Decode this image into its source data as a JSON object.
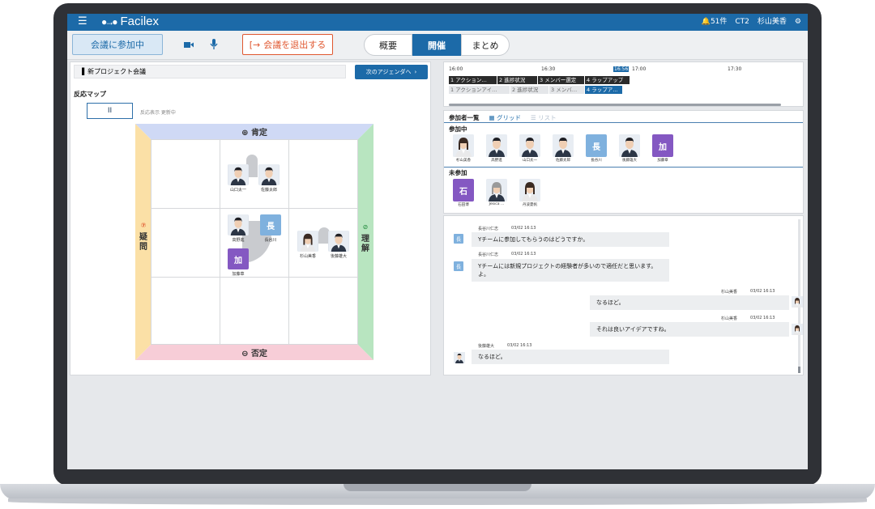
{
  "app": {
    "logo": "Facilex",
    "notifications": "51件",
    "room": "CT2",
    "user": "杉山美香"
  },
  "toolbar": {
    "join_label": "会議に参加中",
    "leave_label": "会議を退出する",
    "tabs": [
      "概要",
      "開催",
      "まとめ"
    ],
    "active_tab": "開催"
  },
  "agenda": {
    "meeting_title": "新プロジェクト会議",
    "next_label": "次のアジェンダへ"
  },
  "reaction_map": {
    "title": "反応マップ",
    "pause_label": "II",
    "status": "反応表示 更新中",
    "top": "肯定",
    "top_sym": "⊕",
    "bottom": "否定",
    "bottom_sym": "⊖",
    "left_sym": "?",
    "left": "疑問",
    "right_sym": "⊘",
    "right": "理解",
    "names": {
      "yamaguchi": "山口太一",
      "sato": "佐藤太郎",
      "takano": "高野進",
      "hasegawa": "長谷川",
      "sugiyama": "杉山美香",
      "goto": "後藤雄大",
      "kato": "加藤章"
    },
    "tile_chars": {
      "hasegawa": "長",
      "kato": "加"
    }
  },
  "timeline": {
    "times": [
      "16:00",
      "16:30",
      "16:56",
      "17:00",
      "17:30"
    ],
    "now": "16:56",
    "actual_row": [
      "1 アクション…",
      "2 進捗状況",
      "3 メンバー選定",
      "4 ラップアップ"
    ],
    "planned_row": [
      "1 アクションアイ…",
      "2 進捗状況",
      "3 メンバ…",
      "4 ラップア…"
    ]
  },
  "participants": {
    "title": "参加者一覧",
    "grid_label": "グリッド",
    "list_label": "リスト",
    "joined_label": "参加中",
    "absent_label": "未参加",
    "joined": [
      {
        "name": "杉山美香",
        "type": "face-f"
      },
      {
        "name": "高野進",
        "type": "face-m"
      },
      {
        "name": "山口太一",
        "type": "face-m"
      },
      {
        "name": "佐藤太郎",
        "type": "face-m"
      },
      {
        "name": "長谷川",
        "type": "tile-b",
        "char": "長"
      },
      {
        "name": "後藤雄大",
        "type": "face-m"
      },
      {
        "name": "加藤章",
        "type": "tile-p",
        "char": "加"
      }
    ],
    "absent": [
      {
        "name": "石田博",
        "type": "tile-p",
        "char": "石"
      },
      {
        "name": "Jesica …",
        "type": "face-g"
      },
      {
        "name": "丹波夏帆",
        "type": "face-f"
      }
    ]
  },
  "chat": {
    "messages": [
      {
        "author": "長谷川仁志",
        "time": "03/02 16:13",
        "text": "Yチームに参加してもらうのはどうですか。",
        "side": "left",
        "avatar": "長"
      },
      {
        "author": "長谷川仁志",
        "time": "03/02 16:13",
        "text": "Yチームには新規プロジェクトの経験者が多いので適任だと思います。よ。",
        "side": "left",
        "avatar": "長"
      },
      {
        "author": "杉山美香",
        "time": "03/02 16:13",
        "text": "なるほど。",
        "side": "right"
      },
      {
        "author": "杉山美香",
        "time": "03/02 16:13",
        "text": "それは良いアイデアですね。",
        "side": "right"
      },
      {
        "author": "後藤雄大",
        "time": "03/02 16:13",
        "text": "なるほど。",
        "side": "left"
      }
    ]
  },
  "colors": {
    "primary": "#1c6aa8",
    "leave": "#e0572f",
    "tile_blue": "#7fb1de",
    "tile_purple": "#8458c2"
  }
}
